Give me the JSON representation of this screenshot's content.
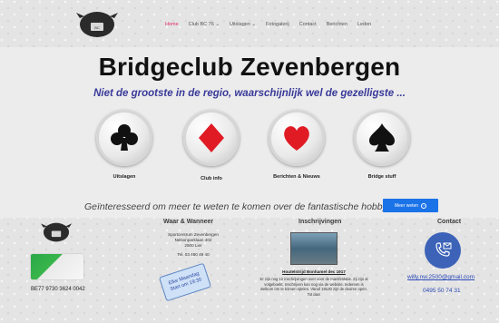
{
  "nav": {
    "items": [
      {
        "label": "Home",
        "active": true
      },
      {
        "label": "Club BC 76",
        "caret": "⌄"
      },
      {
        "label": "Uitslagen",
        "caret": "⌄"
      },
      {
        "label": "Fotogalerij"
      },
      {
        "label": "Contact"
      },
      {
        "label": "Berichten"
      },
      {
        "label": "Leden"
      }
    ]
  },
  "hero": {
    "title": "Bridgeclub Zevenbergen",
    "tagline": "Niet de grootste in de regio, waarschijnlijk wel de gezelligste ..."
  },
  "suits": [
    {
      "label": "Uitslagen",
      "icon": "club-icon",
      "color": "#111111"
    },
    {
      "label": "Club info",
      "icon": "diamond-icon",
      "color": "#e01b24"
    },
    {
      "label": "Berichten & Nieuws",
      "icon": "heart-icon",
      "color": "#e01b24"
    },
    {
      "label": "Bridge stuff",
      "icon": "spade-icon",
      "color": "#111111"
    }
  ],
  "cta": {
    "text": "Geïnteresseerd om meer te weten te komen over de fantastische hobby ...?",
    "button_label": "Meer weten"
  },
  "footer": {
    "venue": {
      "title": "Waar & Wanneer",
      "address_lines": [
        "Sportcentrum Zevenbergen",
        "Nelsonparklaan 402",
        "2500 Lier"
      ],
      "phone": "Tel. 03 480 49 40",
      "sticky_line1": "Elke Maandag",
      "sticky_line2": "Start om 19:30"
    },
    "iban": "BE77 9730 3624 0042",
    "news": {
      "title": "Inschrijvingen",
      "headline": "Houtelstrijd Bonhamel dec 1917",
      "text": "Er zijn nog 12 inschrijvingen over voor de manifestatie. Zij zijn al volgeboekt. Inschrijven kan nog via de website. Iedereen is welkom om te komen spelen. Vanaf 19u30 zijn de deuren open. Tot dan!"
    },
    "contact": {
      "title": "Contact",
      "email": "willy.nw.2500@gmail.com",
      "phone": "0495 50 74 31"
    }
  },
  "colors": {
    "accent": "#1b73e8",
    "nav_active": "#e0246b",
    "tagline": "#3a3a9a",
    "contact_circle": "#3c63b8"
  }
}
